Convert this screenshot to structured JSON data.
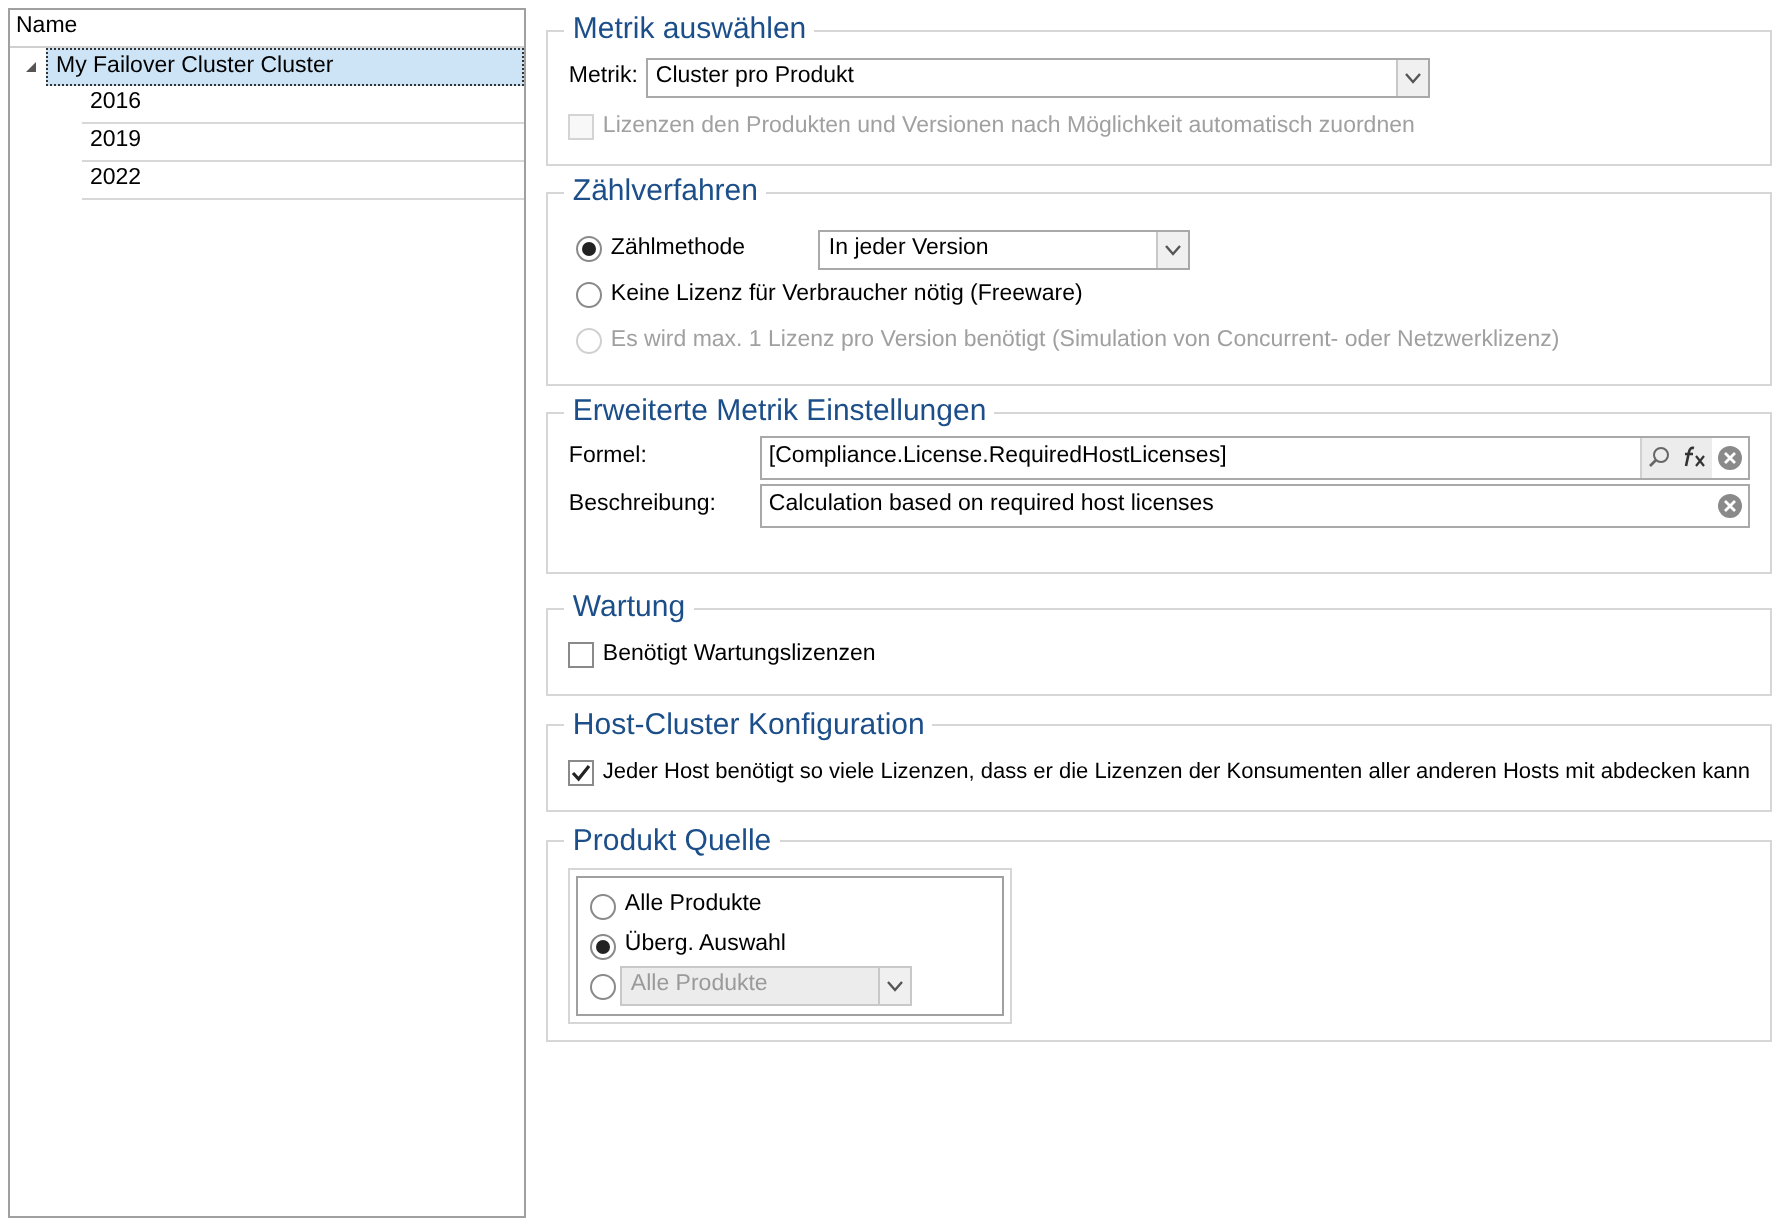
{
  "tree": {
    "column": "Name",
    "items": [
      {
        "label": "My Failover Cluster Cluster",
        "selected": true,
        "expanded": true,
        "children": [
          {
            "label": "2016",
            "selected": false
          },
          {
            "label": "2019",
            "selected": false
          },
          {
            "label": "2022",
            "selected": false
          }
        ]
      }
    ]
  },
  "metric": {
    "title": "Metrik auswählen",
    "label": "Metrik:",
    "value": "Cluster pro Produkt",
    "auto_assign": {
      "label": "Lizenzen den Produkten und Versionen nach Möglichkeit automatisch zuordnen",
      "checked": false,
      "disabled": true
    }
  },
  "counting": {
    "title": "Zählverfahren",
    "options": [
      {
        "kind": "select",
        "label": "Zählmethode",
        "selected": true,
        "disabled": false,
        "value": "In jeder Version"
      },
      {
        "kind": "plain",
        "label": "Keine Lizenz für Verbraucher nötig (Freeware)",
        "selected": false,
        "disabled": false
      },
      {
        "kind": "plain",
        "label": "Es wird max. 1 Lizenz pro Version benötigt (Simulation von Concurrent- oder Netzwerklizenz)",
        "selected": false,
        "disabled": true
      }
    ]
  },
  "advanced": {
    "title": "Erweiterte Metrik Einstellungen",
    "fields": [
      {
        "kind": "formula",
        "label": "Formel:",
        "value": "[Compliance.License.RequiredHostLicenses]"
      },
      {
        "kind": "text",
        "label": "Beschreibung:",
        "value": "Calculation based on required host licenses"
      }
    ]
  },
  "maintenance": {
    "title": "Wartung",
    "checkbox": {
      "label": "Benötigt Wartungslizenzen",
      "checked": false,
      "disabled": false
    }
  },
  "host_cluster": {
    "title": "Host-Cluster Konfiguration",
    "checkbox": {
      "label": "Jeder Host benötigt so viele Lizenzen, dass er die Lizenzen der Konsumenten aller anderen Hosts mit abdecken kann",
      "checked": true,
      "disabled": false
    }
  },
  "product_source": {
    "title": "Produkt Quelle",
    "options": [
      {
        "kind": "plain",
        "label": "Alle Produkte",
        "selected": false,
        "disabled": false
      },
      {
        "kind": "plain",
        "label": "Überg. Auswahl",
        "selected": true,
        "disabled": false
      },
      {
        "kind": "select",
        "selected": false,
        "disabled": false,
        "value": "Alle Produkte",
        "select_disabled": true
      }
    ]
  }
}
